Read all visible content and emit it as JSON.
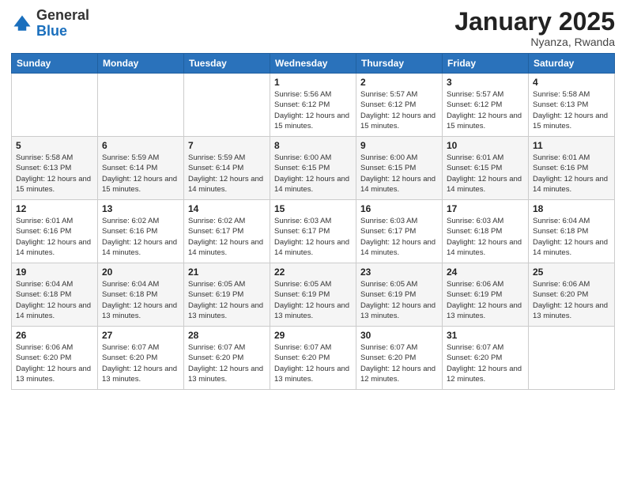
{
  "logo": {
    "general": "General",
    "blue": "Blue"
  },
  "header": {
    "title": "January 2025",
    "location": "Nyanza, Rwanda"
  },
  "weekdays": [
    "Sunday",
    "Monday",
    "Tuesday",
    "Wednesday",
    "Thursday",
    "Friday",
    "Saturday"
  ],
  "weeks": [
    [
      {
        "day": "",
        "info": ""
      },
      {
        "day": "",
        "info": ""
      },
      {
        "day": "",
        "info": ""
      },
      {
        "day": "1",
        "info": "Sunrise: 5:56 AM\nSunset: 6:12 PM\nDaylight: 12 hours\nand 15 minutes."
      },
      {
        "day": "2",
        "info": "Sunrise: 5:57 AM\nSunset: 6:12 PM\nDaylight: 12 hours\nand 15 minutes."
      },
      {
        "day": "3",
        "info": "Sunrise: 5:57 AM\nSunset: 6:12 PM\nDaylight: 12 hours\nand 15 minutes."
      },
      {
        "day": "4",
        "info": "Sunrise: 5:58 AM\nSunset: 6:13 PM\nDaylight: 12 hours\nand 15 minutes."
      }
    ],
    [
      {
        "day": "5",
        "info": "Sunrise: 5:58 AM\nSunset: 6:13 PM\nDaylight: 12 hours\nand 15 minutes."
      },
      {
        "day": "6",
        "info": "Sunrise: 5:59 AM\nSunset: 6:14 PM\nDaylight: 12 hours\nand 15 minutes."
      },
      {
        "day": "7",
        "info": "Sunrise: 5:59 AM\nSunset: 6:14 PM\nDaylight: 12 hours\nand 14 minutes."
      },
      {
        "day": "8",
        "info": "Sunrise: 6:00 AM\nSunset: 6:15 PM\nDaylight: 12 hours\nand 14 minutes."
      },
      {
        "day": "9",
        "info": "Sunrise: 6:00 AM\nSunset: 6:15 PM\nDaylight: 12 hours\nand 14 minutes."
      },
      {
        "day": "10",
        "info": "Sunrise: 6:01 AM\nSunset: 6:15 PM\nDaylight: 12 hours\nand 14 minutes."
      },
      {
        "day": "11",
        "info": "Sunrise: 6:01 AM\nSunset: 6:16 PM\nDaylight: 12 hours\nand 14 minutes."
      }
    ],
    [
      {
        "day": "12",
        "info": "Sunrise: 6:01 AM\nSunset: 6:16 PM\nDaylight: 12 hours\nand 14 minutes."
      },
      {
        "day": "13",
        "info": "Sunrise: 6:02 AM\nSunset: 6:16 PM\nDaylight: 12 hours\nand 14 minutes."
      },
      {
        "day": "14",
        "info": "Sunrise: 6:02 AM\nSunset: 6:17 PM\nDaylight: 12 hours\nand 14 minutes."
      },
      {
        "day": "15",
        "info": "Sunrise: 6:03 AM\nSunset: 6:17 PM\nDaylight: 12 hours\nand 14 minutes."
      },
      {
        "day": "16",
        "info": "Sunrise: 6:03 AM\nSunset: 6:17 PM\nDaylight: 12 hours\nand 14 minutes."
      },
      {
        "day": "17",
        "info": "Sunrise: 6:03 AM\nSunset: 6:18 PM\nDaylight: 12 hours\nand 14 minutes."
      },
      {
        "day": "18",
        "info": "Sunrise: 6:04 AM\nSunset: 6:18 PM\nDaylight: 12 hours\nand 14 minutes."
      }
    ],
    [
      {
        "day": "19",
        "info": "Sunrise: 6:04 AM\nSunset: 6:18 PM\nDaylight: 12 hours\nand 14 minutes."
      },
      {
        "day": "20",
        "info": "Sunrise: 6:04 AM\nSunset: 6:18 PM\nDaylight: 12 hours\nand 13 minutes."
      },
      {
        "day": "21",
        "info": "Sunrise: 6:05 AM\nSunset: 6:19 PM\nDaylight: 12 hours\nand 13 minutes."
      },
      {
        "day": "22",
        "info": "Sunrise: 6:05 AM\nSunset: 6:19 PM\nDaylight: 12 hours\nand 13 minutes."
      },
      {
        "day": "23",
        "info": "Sunrise: 6:05 AM\nSunset: 6:19 PM\nDaylight: 12 hours\nand 13 minutes."
      },
      {
        "day": "24",
        "info": "Sunrise: 6:06 AM\nSunset: 6:19 PM\nDaylight: 12 hours\nand 13 minutes."
      },
      {
        "day": "25",
        "info": "Sunrise: 6:06 AM\nSunset: 6:20 PM\nDaylight: 12 hours\nand 13 minutes."
      }
    ],
    [
      {
        "day": "26",
        "info": "Sunrise: 6:06 AM\nSunset: 6:20 PM\nDaylight: 12 hours\nand 13 minutes."
      },
      {
        "day": "27",
        "info": "Sunrise: 6:07 AM\nSunset: 6:20 PM\nDaylight: 12 hours\nand 13 minutes."
      },
      {
        "day": "28",
        "info": "Sunrise: 6:07 AM\nSunset: 6:20 PM\nDaylight: 12 hours\nand 13 minutes."
      },
      {
        "day": "29",
        "info": "Sunrise: 6:07 AM\nSunset: 6:20 PM\nDaylight: 12 hours\nand 13 minutes."
      },
      {
        "day": "30",
        "info": "Sunrise: 6:07 AM\nSunset: 6:20 PM\nDaylight: 12 hours\nand 12 minutes."
      },
      {
        "day": "31",
        "info": "Sunrise: 6:07 AM\nSunset: 6:20 PM\nDaylight: 12 hours\nand 12 minutes."
      },
      {
        "day": "",
        "info": ""
      }
    ]
  ]
}
